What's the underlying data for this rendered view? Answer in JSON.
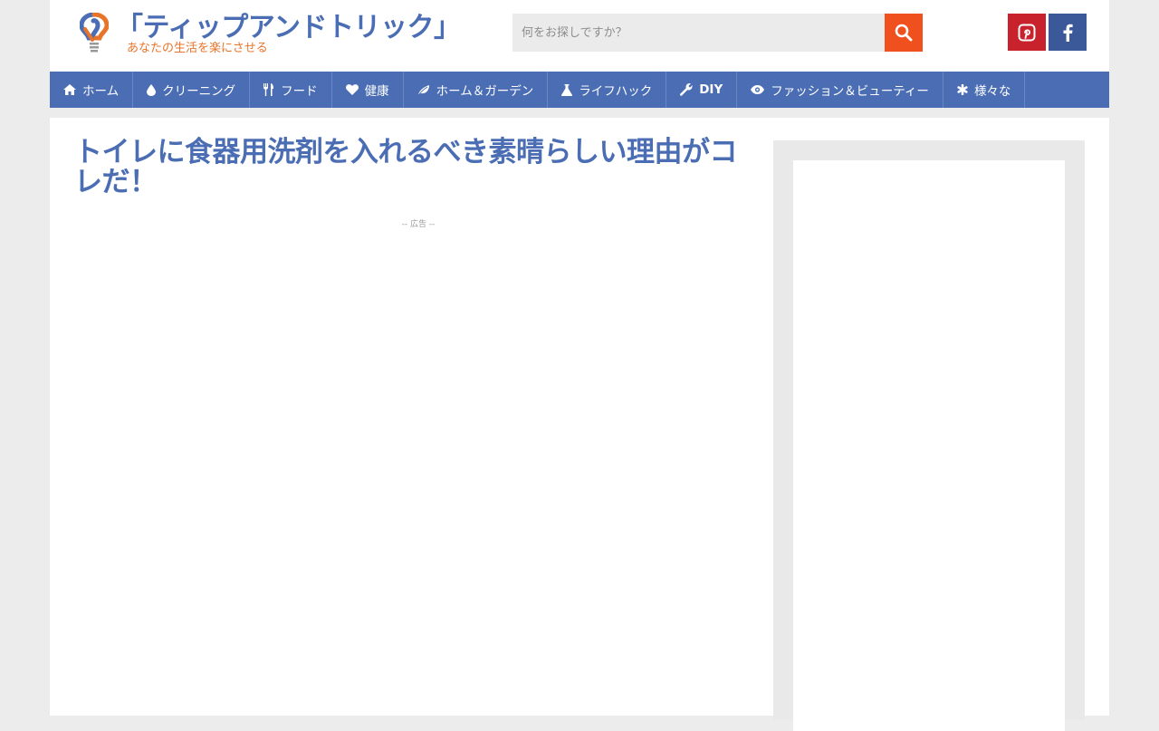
{
  "site": {
    "title": "「ティップアンドトリック」",
    "tagline": "あなたの生活を楽にさせる"
  },
  "search": {
    "placeholder": "何をお探しですか？"
  },
  "social": [
    {
      "name": "Pinterest",
      "icon": "pinterest-icon",
      "color": "#c8232c"
    },
    {
      "name": "Facebook",
      "icon": "facebook-icon",
      "color": "#3b5998"
    }
  ],
  "nav": {
    "items": [
      {
        "label": "ホーム",
        "icon": "home-icon"
      },
      {
        "label": "クリーニング",
        "icon": "drop-icon"
      },
      {
        "label": "フード",
        "icon": "cutlery-icon"
      },
      {
        "label": "健康",
        "icon": "heart-icon"
      },
      {
        "label": "ホーム＆ガーデン",
        "icon": "leaf-icon"
      },
      {
        "label": "ライフハック",
        "icon": "flask-icon"
      },
      {
        "label": "DIY",
        "icon": "wrench-icon"
      },
      {
        "label": "ファッション＆ビューティー",
        "icon": "eye-icon"
      },
      {
        "label": "様々な",
        "icon": "asterisk-icon"
      }
    ]
  },
  "article": {
    "title": "トイレに食器用洗剤を入れるべき素晴らしい理由がコレだ！",
    "ad_label": "-- 広告 --"
  },
  "colors": {
    "brand_blue": "#4a6db4",
    "accent_orange": "#f0501e",
    "tagline_orange": "#e8742a"
  }
}
